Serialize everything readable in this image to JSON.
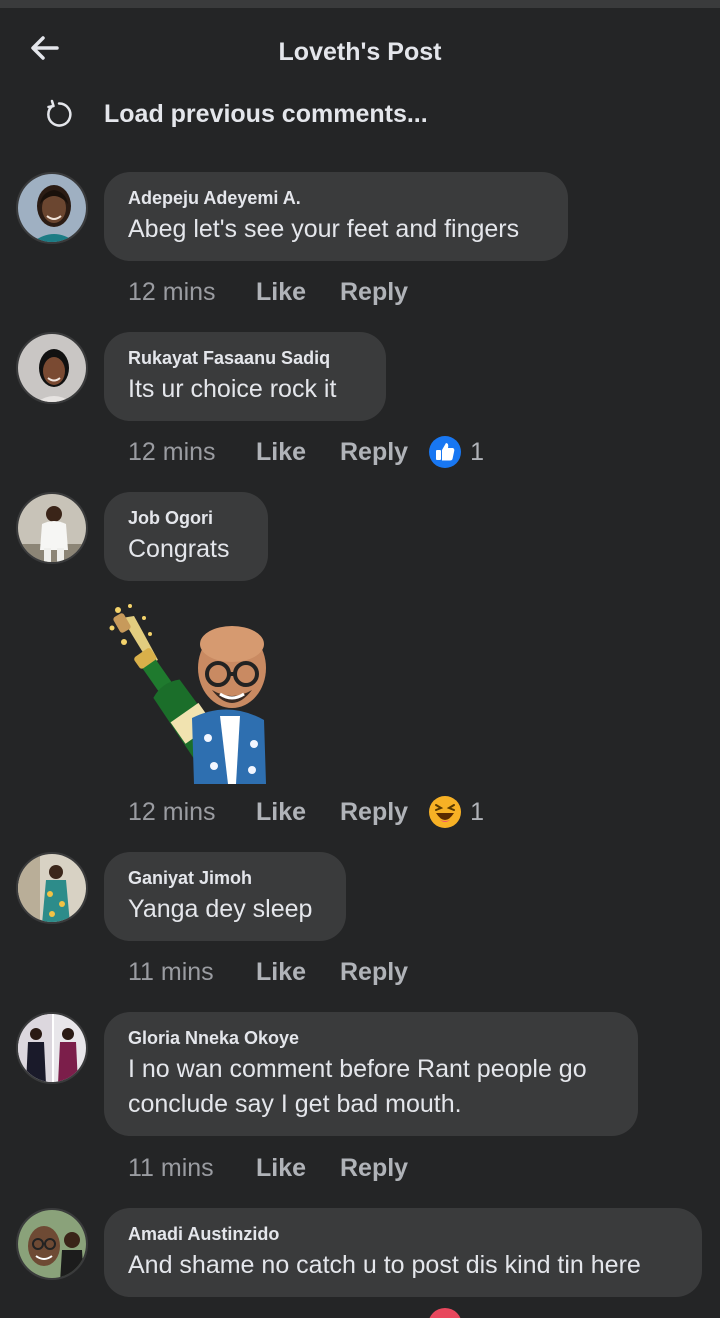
{
  "header": {
    "title": "Loveth's Post"
  },
  "load_previous": "Load previous comments...",
  "comments": [
    {
      "author": "Adepeju Adeyemi A.",
      "text": "Abeg let's see your feet and fingers",
      "time": "12 mins",
      "like": "Like",
      "reply": "Reply"
    },
    {
      "author": "Rukayat Fasaanu Sadiq",
      "text": "Its ur  choice rock it",
      "time": "12 mins",
      "like": "Like",
      "reply": "Reply",
      "reaction": {
        "icon": "like-reaction-icon",
        "count": "1"
      }
    },
    {
      "author": "Job Ogori",
      "text": "Congrats",
      "time": "12 mins",
      "like": "Like",
      "reply": "Reply",
      "sticker": "avatar-champagne-sticker",
      "reaction": {
        "icon": "haha-reaction-icon",
        "count": "1"
      }
    },
    {
      "author": "Ganiyat Jimoh",
      "text": "Yanga dey sleep",
      "time": "11 mins",
      "like": "Like",
      "reply": "Reply"
    },
    {
      "author": "Gloria Nneka Okoye",
      "text_lines": [
        "I no wan comment before Rant people go",
        "conclude say I get bad mouth."
      ],
      "time": "11 mins",
      "like": "Like",
      "reply": "Reply"
    },
    {
      "author": "Amadi Austinzido",
      "text": "And shame no catch u to post dis kind tin here"
    }
  ],
  "colors": {
    "background": "#242526",
    "bubble": "#3a3b3c",
    "text": "#e4e6eb",
    "muted": "#b0b3b8",
    "like_blue": "#1877f2",
    "haha_yellow": "#f7b125"
  }
}
